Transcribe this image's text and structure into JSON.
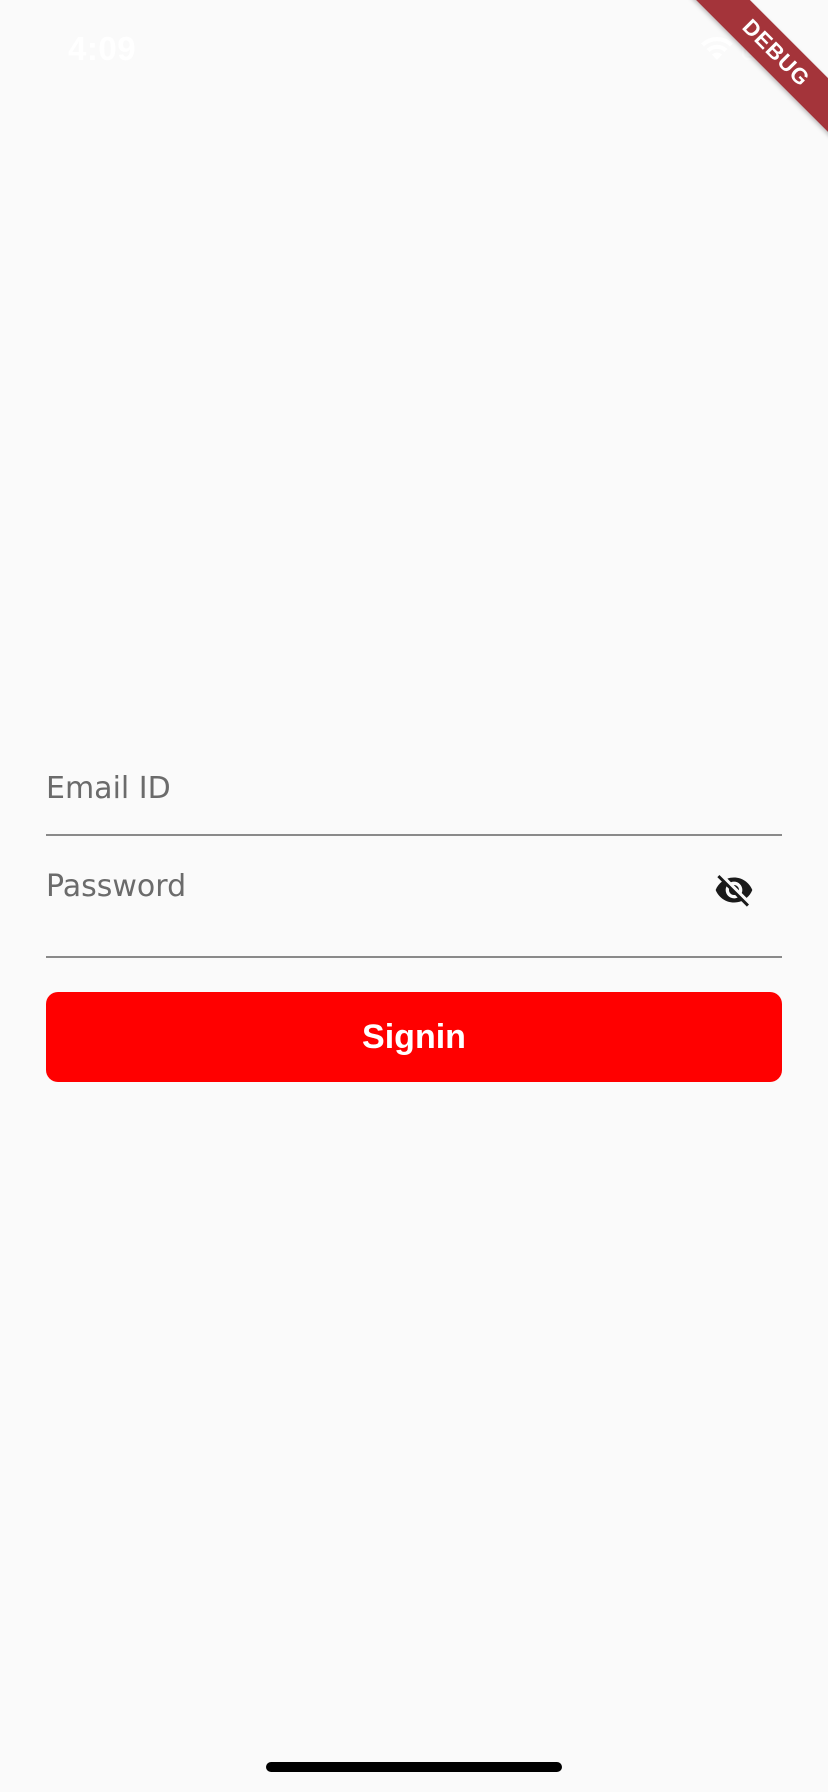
{
  "status_bar": {
    "time": "4:09",
    "wifi_icon": "wifi-icon",
    "battery_icon": "battery-icon"
  },
  "debug_banner": {
    "label": "DEBUG",
    "color": "#a4343a"
  },
  "login_form": {
    "email": {
      "placeholder": "Email ID",
      "value": ""
    },
    "password": {
      "placeholder": "Password",
      "value": "",
      "visibility_icon": "eye-off-icon"
    },
    "signin_button": {
      "label": "Signin",
      "color": "#ff0000"
    }
  },
  "colors": {
    "background": "#fafafa",
    "underline": "#8a8a8a",
    "placeholder": "#6b6b6b"
  }
}
